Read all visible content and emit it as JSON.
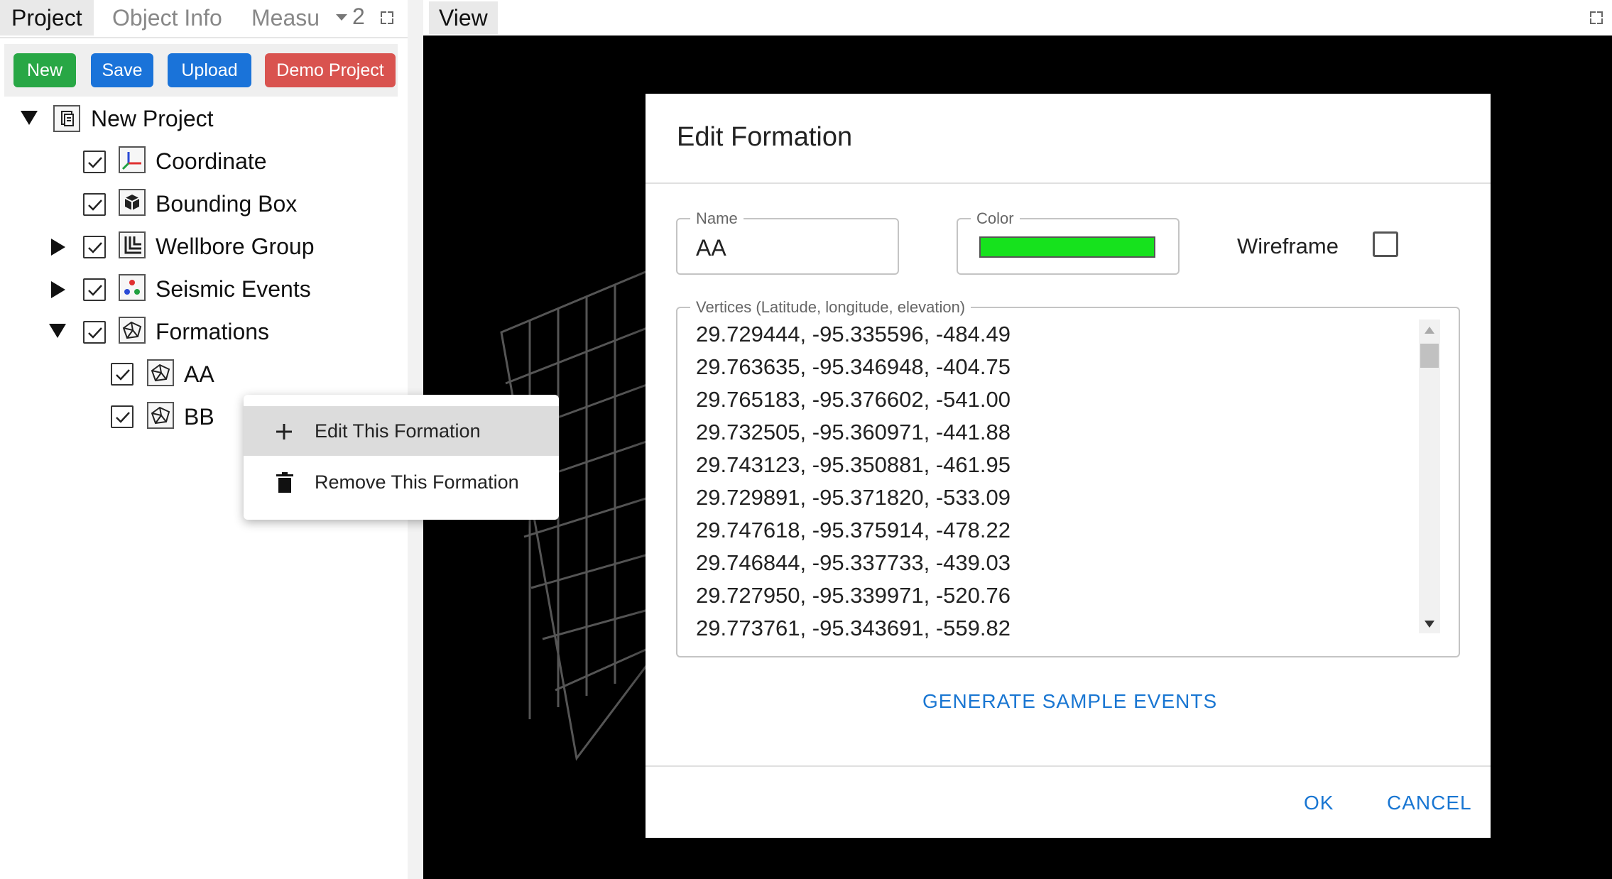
{
  "left_panel": {
    "tabs": [
      {
        "label": "Project",
        "active": true
      },
      {
        "label": "Object Info",
        "active": false
      },
      {
        "label": "Measu",
        "active": false
      }
    ],
    "overflow_count": "2",
    "toolbar": {
      "new_label": "New",
      "save_label": "Save",
      "upload_label": "Upload",
      "demo_label": "Demo Project"
    },
    "tree": {
      "root": "New Project",
      "items": [
        "Coordinate",
        "Bounding Box",
        "Wellbore Group",
        "Seismic Events",
        "Formations"
      ],
      "formations": [
        "AA",
        "BB"
      ]
    }
  },
  "view_panel": {
    "tab_label": "View"
  },
  "context_menu": {
    "items": [
      {
        "label": "Edit This Formation",
        "icon": "plus-icon"
      },
      {
        "label": "Remove This Formation",
        "icon": "trash-icon"
      }
    ]
  },
  "dialog": {
    "title": "Edit Formation",
    "name_label": "Name",
    "name_value": "AA",
    "color_label": "Color",
    "color_value": "#16e21d",
    "wireframe_label": "Wireframe",
    "wireframe_checked": false,
    "vertices_label": "Vertices (Latitude, longitude, elevation)",
    "vertices": [
      "29.729444, -95.335596, -484.49",
      "29.763635, -95.346948, -404.75",
      "29.765183, -95.376602, -541.00",
      "29.732505, -95.360971, -441.88",
      "29.743123, -95.350881, -461.95",
      "29.729891, -95.371820, -533.09",
      "29.747618, -95.375914, -478.22",
      "29.746844, -95.337733, -439.03",
      "29.727950, -95.339971, -520.76",
      "29.773761, -95.343691, -559.82"
    ],
    "generate_label": "GENERATE SAMPLE EVENTS",
    "ok_label": "OK",
    "cancel_label": "CANCEL"
  },
  "colors": {
    "new_button": "#28a745",
    "save_button": "#1a73d9",
    "upload_button": "#1a73d9",
    "demo_button": "#d9534f",
    "link_blue": "#1976d2"
  }
}
